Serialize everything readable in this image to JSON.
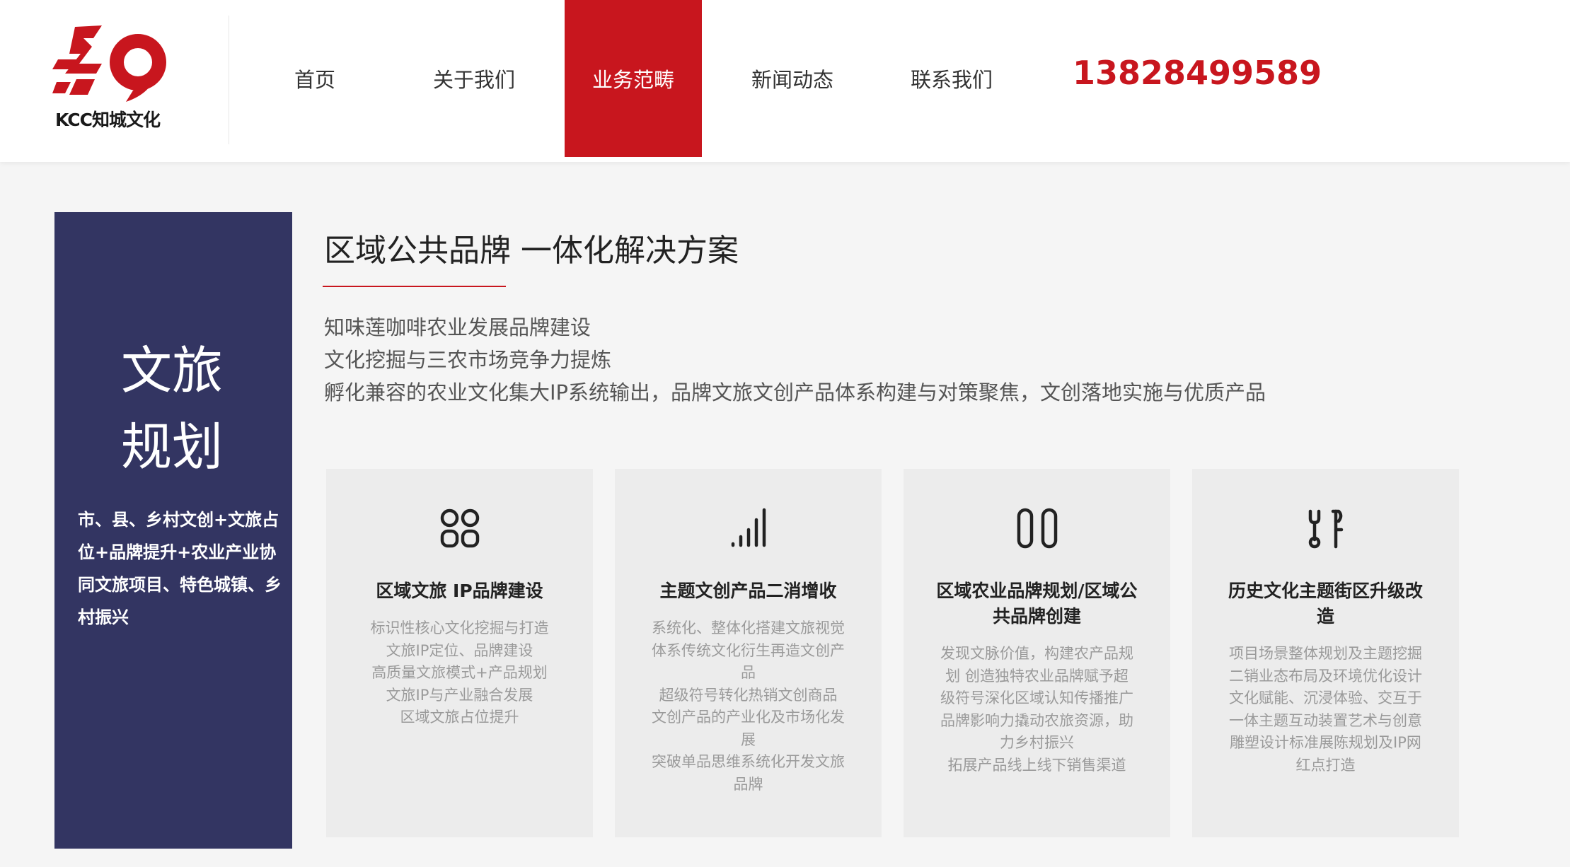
{
  "header": {
    "logo_text": "KCC知城文化",
    "nav": [
      {
        "label": "首页",
        "active": false
      },
      {
        "label": "关于我们",
        "active": false
      },
      {
        "label": "业务范畴",
        "active": true
      },
      {
        "label": "新闻动态",
        "active": false
      },
      {
        "label": "联系我们",
        "active": false
      }
    ],
    "phone": "13828499589"
  },
  "sidebar": {
    "title_line1": "文旅",
    "title_line2": "规划",
    "description": "市、县、乡村文创+文旅占位+品牌提升+农业产业协同文旅项目、特色城镇、乡村振兴"
  },
  "main": {
    "title": "区域公共品牌 一体化解决方案",
    "intro_lines": [
      "知味莲咖啡农业发展品牌建设",
      "文化挖掘与三农市场竞争力提炼",
      "孵化兼容的农业文化集大IP系统输出，品牌文旅文创产品体系构建与对策聚焦，文创落地实施与优质产品"
    ]
  },
  "cards": [
    {
      "icon": "grid-four-icon",
      "title": "区域文旅 IP品牌建设",
      "lines": [
        "标识性核心文化挖掘与打造",
        "文旅IP定位、品牌建设",
        "高质量文旅模式+产品规划",
        "文旅IP与产业融合发展",
        "区域文旅占位提升"
      ]
    },
    {
      "icon": "bar-chart-icon",
      "title": "主题文创产品二消增收",
      "lines": [
        "系统化、整体化搭建文旅视觉体系传统文化衍生再造文创产品",
        "超级符号转化热销文创商品",
        "文创产品的产业化及市场化发展",
        "突破单品思维系统化开发文旅品牌"
      ]
    },
    {
      "icon": "double-pill-icon",
      "title": "区域农业品牌规划/区域公共品牌创建",
      "lines": [
        "发现文脉价值，构建农产品规划 创造独特农业品牌赋予超级符号深化区域认知传播推广品牌影响力撬动农旅资源，助力乡村振兴",
        "拓展产品线上线下销售渠道"
      ]
    },
    {
      "icon": "tools-icon",
      "title": "历史文化主题街区升级改造",
      "lines": [
        "项目场景整体规划及主题挖掘二销业态布局及环境优化设计",
        "文化赋能、沉浸体验、交互于一体主题互动装置艺术与创意雕塑设计标准展陈规划及IP网红点打造"
      ]
    }
  ],
  "colors": {
    "brand_red": "#c8161e",
    "sidebar_navy": "#333562",
    "card_bg": "#ececec"
  }
}
